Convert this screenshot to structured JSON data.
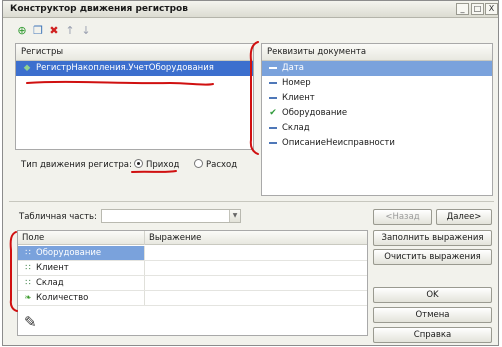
{
  "window": {
    "title": "Конструктор движения регистров",
    "controls": [
      "_",
      "□",
      "X"
    ]
  },
  "toolbar": {
    "icons": [
      "add-icon",
      "copy-icon",
      "delete-icon",
      "move-up-icon",
      "move-down-icon"
    ]
  },
  "registers_panel": {
    "header": "Регистры",
    "items": [
      {
        "label": "РегистрНакопления.УчетОборудования",
        "selected": true
      }
    ]
  },
  "movement_type": {
    "label": "Тип движения регистра:",
    "options": [
      {
        "label": "Приход",
        "selected": true
      },
      {
        "label": "Расход",
        "selected": false
      }
    ]
  },
  "requisites_panel": {
    "header": "Реквизиты документа",
    "items": [
      {
        "label": "Дата",
        "icon": "field-icon",
        "selected": true
      },
      {
        "label": "Номер",
        "icon": "field-icon"
      },
      {
        "label": "Клиент",
        "icon": "field-icon"
      },
      {
        "label": "Оборудование",
        "icon": "field-check-icon"
      },
      {
        "label": "Склад",
        "icon": "field-icon"
      },
      {
        "label": "ОписаниеНеисправности",
        "icon": "field-icon"
      }
    ]
  },
  "tabular_part": {
    "label": "Табличная часть:",
    "value": ""
  },
  "nav": {
    "back": "<Назад",
    "next": "Далее>"
  },
  "grid": {
    "columns": [
      "Поле",
      "Выражение"
    ],
    "rows": [
      {
        "field": "Оборудование",
        "expression": "",
        "icon": "dimension-icon",
        "selected": true
      },
      {
        "field": "Клиент",
        "expression": "",
        "icon": "dimension-icon"
      },
      {
        "field": "Склад",
        "expression": "",
        "icon": "dimension-icon"
      },
      {
        "field": "Количество",
        "expression": "",
        "icon": "resource-icon"
      }
    ]
  },
  "actions": {
    "fill": "Заполнить выражения",
    "clear": "Очистить выражения",
    "ok": "OK",
    "cancel": "Отмена",
    "help": "Справка"
  },
  "annotations": {
    "color": "#d01010"
  }
}
